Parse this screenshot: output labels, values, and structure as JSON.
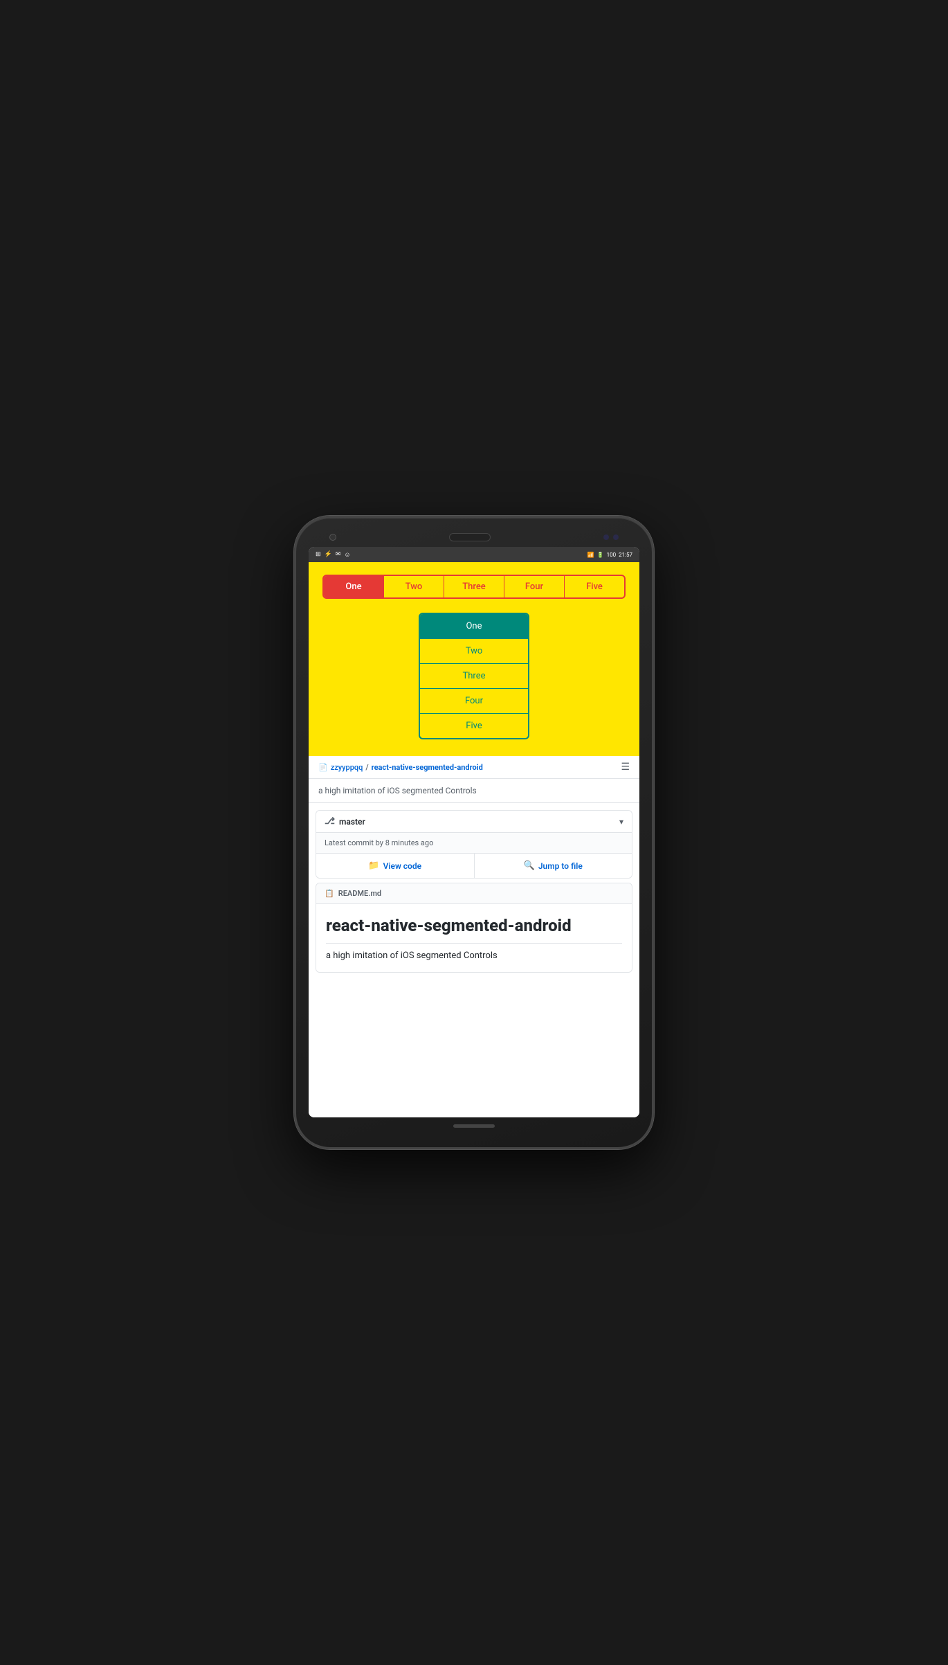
{
  "phone": {
    "status_bar": {
      "time": "21:57",
      "battery": "100",
      "signal_icons": "WiFi 4G",
      "left_icons": [
        "grid-icon",
        "usb-icon",
        "message-icon",
        "emoji-icon"
      ]
    }
  },
  "app": {
    "background_color": "#FFE600",
    "segmented_row": {
      "items": [
        {
          "label": "One",
          "active": true
        },
        {
          "label": "Two",
          "active": false
        },
        {
          "label": "Three",
          "active": false
        },
        {
          "label": "Four",
          "active": false
        },
        {
          "label": "Five",
          "active": false
        }
      ]
    },
    "segmented_list": {
      "items": [
        {
          "label": "One",
          "active": true
        },
        {
          "label": "Two",
          "active": false
        },
        {
          "label": "Three",
          "active": false
        },
        {
          "label": "Four",
          "active": false
        },
        {
          "label": "Five",
          "active": false
        }
      ]
    }
  },
  "github": {
    "repo_owner": "zzyyppqq",
    "repo_name": "react-native-segmented-android",
    "description": "a high imitation of iOS segmented Controls",
    "branch": {
      "name": "master",
      "commit_text": "Latest commit by 8 minutes ago"
    },
    "actions": {
      "view_code_label": "View code",
      "jump_to_file_label": "Jump to file"
    },
    "readme": {
      "filename": "README.md",
      "title": "react-native-segmented-android",
      "description": "a high imitation of iOS segmented Controls"
    }
  },
  "colors": {
    "accent_red": "#e53935",
    "accent_teal": "#00897b",
    "github_blue": "#0366d6",
    "yellow_bg": "#FFE600"
  }
}
